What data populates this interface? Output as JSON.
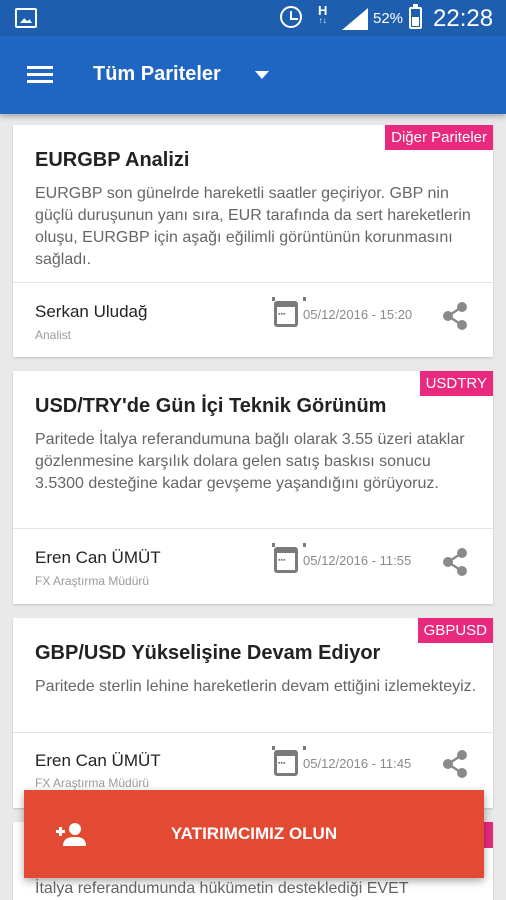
{
  "status_bar": {
    "network": "H",
    "network_sub": "↑↓",
    "battery": "52%",
    "time": "22:28"
  },
  "app_bar": {
    "title": "Tüm Pariteler"
  },
  "articles": [
    {
      "tag": "Diğer Pariteler",
      "title": "EURGBP Analizi",
      "desc": "EURGBP son günelrde hareketli saatler geçiriyor.  GBP nin güçlü duruşunun yanı sıra, EUR tarafında da sert hareketlerin oluşu,  EURGBP için aşağı eğilimli görüntünün korunmasını sağladı.",
      "author": "Serkan Uludağ",
      "role": "Analist",
      "date": "05/12/2016 - 15:20"
    },
    {
      "tag": "USDTRY",
      "title": "USD/TRY'de Gün İçi Teknik Görünüm",
      "desc": "Paritede İtalya referandumuna bağlı olarak 3.55 üzeri ataklar gözlenmesine karşılık dolara gelen satış baskısı sonucu 3.5300 desteğine kadar gevşeme yaşandığını görüyoruz.",
      "author": "Eren Can ÜMÜT",
      "role": "FX Araştırma Müdürü",
      "date": "05/12/2016 - 11:55"
    },
    {
      "tag": "GBPUSD",
      "title": "GBP/USD Yükselişine Devam Ediyor",
      "desc": "Paritede sterlin lehine hareketlerin devam ettiğini izlemekteyiz.",
      "author": "Eren Can ÜMÜT",
      "role": "FX Araştırma Müdürü",
      "date": "05/12/2016 - 11:45"
    },
    {
      "desc": "İtalya referandumunda hükümetin desteklediği EVET"
    }
  ],
  "cta": {
    "label": "YATIRIMCIMIZ OLUN"
  },
  "colors": {
    "status_bar": "#1d5fae",
    "app_bar": "#1e66c1",
    "tag": "#e8297d",
    "cta": "#e24a33",
    "background": "#e9e9e9"
  },
  "icons": [
    "image-icon",
    "alarm-icon",
    "signal-icon",
    "battery-icon",
    "menu-icon",
    "dropdown-icon",
    "calendar-icon",
    "share-icon",
    "add-user-icon"
  ]
}
